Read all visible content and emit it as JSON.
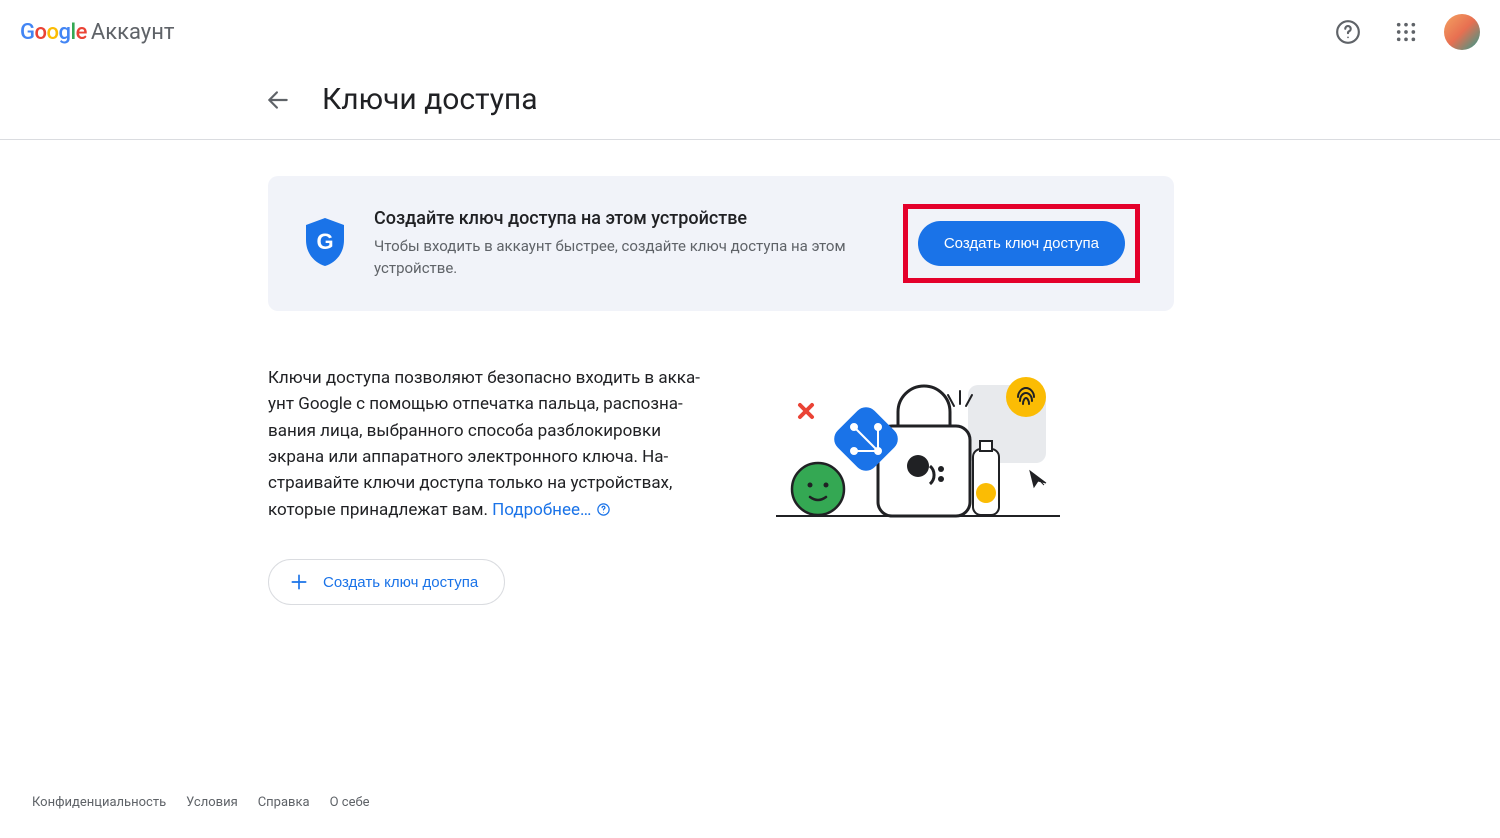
{
  "header": {
    "brand_word": "Аккаунт"
  },
  "page": {
    "title": "Ключи доступа"
  },
  "card": {
    "title": "Создайте ключ доступа на этом устройстве",
    "subtitle": "Чтобы входить в аккаунт быстрее, создайте ключ доступа на этом устройстве.",
    "button": "Создать ключ доступа"
  },
  "description": {
    "text": "Ключи доступа позволяют безопасно входить в акка­унт Google с помощью отпечатка пальца, распозна­вания лица, выбранного способа разблокировки экрана или аппаратного электронного ключа. На­страивайте ключи доступа только на устройствах, которые принадлежат вам. ",
    "learn_more": "Подробнее…"
  },
  "secondary_button": "Создать ключ доступа",
  "footer": {
    "privacy": "Конфиденциальность",
    "terms": "Условия",
    "help": "Справка",
    "about": "О себе"
  }
}
